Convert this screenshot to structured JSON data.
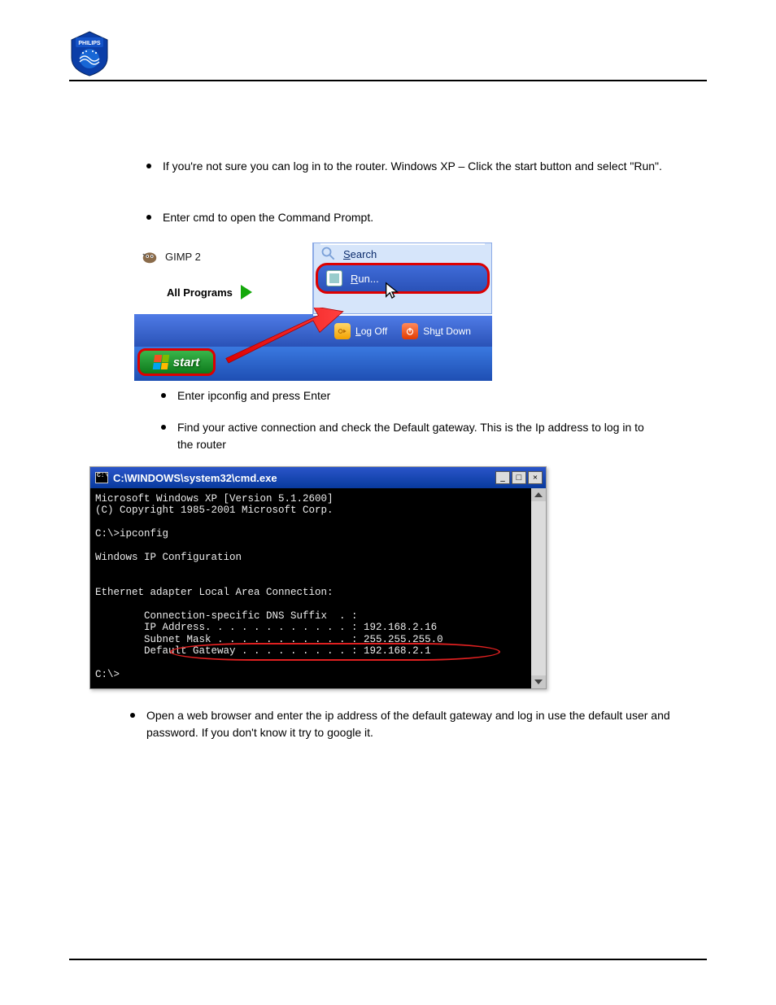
{
  "bullets": {
    "b1": "If you're not sure you can log in to the router. Windows XP – Click the start button and select \"Run\".",
    "b2": "Enter cmd to open the Command Prompt.",
    "b3": "Enter ipconfig and press Enter",
    "b4": "Find your active connection and check the Default gateway. This is the Ip address to log in to the router",
    "b5": "Open a web browser and enter the ip address of the default gateway and log in use the default user and password. If you don't know it try to google it."
  },
  "shot1": {
    "gimp": "GIMP 2",
    "all_programs": "All Programs",
    "search": "Search",
    "run": "Run...",
    "logoff": "Log Off",
    "shutdown": "Shut Down",
    "start": "start"
  },
  "shot2": {
    "title": "C:\\WINDOWS\\system32\\cmd.exe",
    "min": "_",
    "max": "□",
    "close": "×",
    "body": "Microsoft Windows XP [Version 5.1.2600]\n(C) Copyright 1985-2001 Microsoft Corp.\n\nC:\\>ipconfig\n\nWindows IP Configuration\n\n\nEthernet adapter Local Area Connection:\n\n        Connection-specific DNS Suffix  . :\n        IP Address. . . . . . . . . . . . : 192.168.2.16\n        Subnet Mask . . . . . . . . . . . : 255.255.255.0\n        Default Gateway . . . . . . . . . : 192.168.2.1\n\nC:\\>"
  }
}
